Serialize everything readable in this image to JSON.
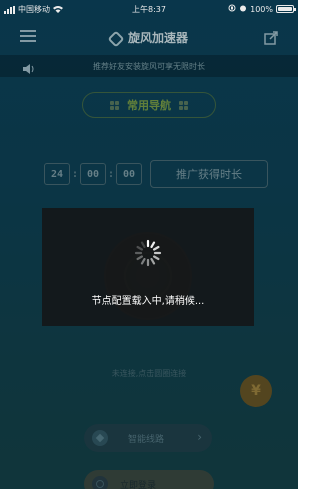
{
  "status_bar": {
    "carrier": "中国移动",
    "time": "上午8:37",
    "battery": "100%"
  },
  "nav": {
    "title": "旋风加速器",
    "menu_icon": "menu-icon",
    "share_icon": "share-icon"
  },
  "notice": {
    "text": "推荐好友安装旋风可享无限时长"
  },
  "route_mode": {
    "label": "常用导航"
  },
  "timer": {
    "hours": "24",
    "minutes": "00",
    "seconds": "00",
    "promo_label": "推广获得时长"
  },
  "connection": {
    "status_text": "未连接,点击圆圈连接"
  },
  "yen_button": {
    "symbol": "¥"
  },
  "smart_route": {
    "label": "智能线路",
    "chevron": "›"
  },
  "bottom_button": {
    "label": "立即登录"
  },
  "loading": {
    "message": "节点配置载入中,请稍候..."
  },
  "colors": {
    "background": "#0c3a4c",
    "loading_panel": "#141618",
    "accent_green": "#6a8a3f",
    "yen_gold": "#5b4b22"
  }
}
